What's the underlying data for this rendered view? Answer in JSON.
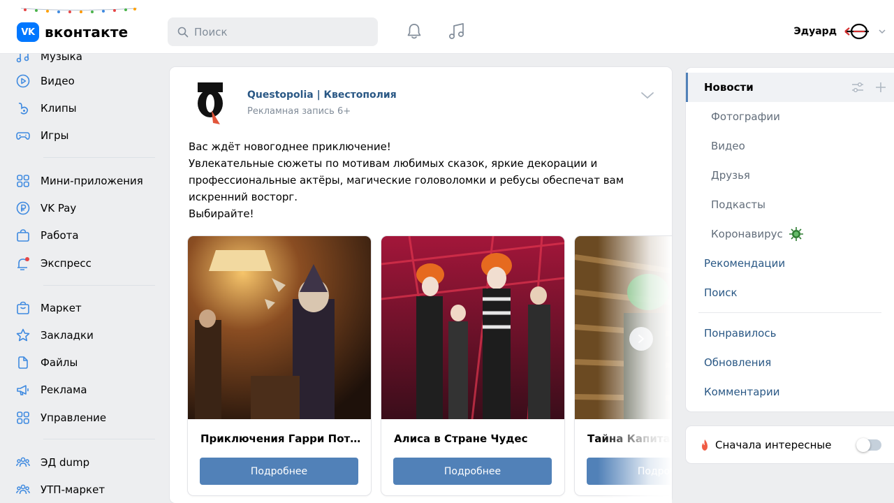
{
  "header": {
    "logo_badge": "VK",
    "logo_text": "вконтакте",
    "search_placeholder": "Поиск",
    "user_name": "Эдуард"
  },
  "sidebar": {
    "items": [
      {
        "label": "Музыка",
        "icon": "music-icon"
      },
      {
        "label": "Видео",
        "icon": "video-icon"
      },
      {
        "label": "Клипы",
        "icon": "clips-icon"
      },
      {
        "label": "Игры",
        "icon": "gamepad-icon"
      },
      {
        "label": "Мини-приложения",
        "icon": "apps-icon"
      },
      {
        "label": "VK Pay",
        "icon": "vkpay-icon"
      },
      {
        "label": "Работа",
        "icon": "briefcase-icon"
      },
      {
        "label": "Экспресс",
        "icon": "express-icon"
      },
      {
        "label": "Маркет",
        "icon": "market-icon"
      },
      {
        "label": "Закладки",
        "icon": "star-icon"
      },
      {
        "label": "Файлы",
        "icon": "file-icon"
      },
      {
        "label": "Реклама",
        "icon": "megaphone-icon"
      },
      {
        "label": "Управление",
        "icon": "apps-icon"
      },
      {
        "label": "ЭД dump",
        "icon": "group-icon"
      },
      {
        "label": "УТП-маркет",
        "icon": "group-icon"
      }
    ]
  },
  "post": {
    "author": "Questopolia | Квестополия",
    "subtitle": "Рекламная запись 6+",
    "text": [
      "Вас ждёт новогоднее приключение!",
      "Увлекательные сюжеты по мотивам любимых сказок, яркие декорации и профессиональные актёры, магические головоломки и ребусы обеспечат вам искренний восторг.",
      "Выбирайте!"
    ],
    "cards": [
      {
        "title": "Приключения Гарри Поттера",
        "button": "Подробнее"
      },
      {
        "title": "Алиса в Стране Чудес",
        "button": "Подробнее"
      },
      {
        "title": "Тайна Капитана",
        "button": "Подробнее"
      }
    ]
  },
  "filters": {
    "items": [
      {
        "label": "Новости"
      },
      {
        "label": "Фотографии"
      },
      {
        "label": "Видео"
      },
      {
        "label": "Друзья"
      },
      {
        "label": "Подкасты"
      },
      {
        "label": "Коронавирус"
      },
      {
        "label": "Рекомендации"
      },
      {
        "label": "Поиск"
      },
      {
        "label": "Понравилось"
      },
      {
        "label": "Обновления"
      },
      {
        "label": "Комментарии"
      }
    ]
  },
  "sort": {
    "label": "Сначала интересные",
    "enabled": false
  },
  "colors": {
    "accent": "#5181b8",
    "link": "#2a5885",
    "brand": "#0077ff"
  }
}
